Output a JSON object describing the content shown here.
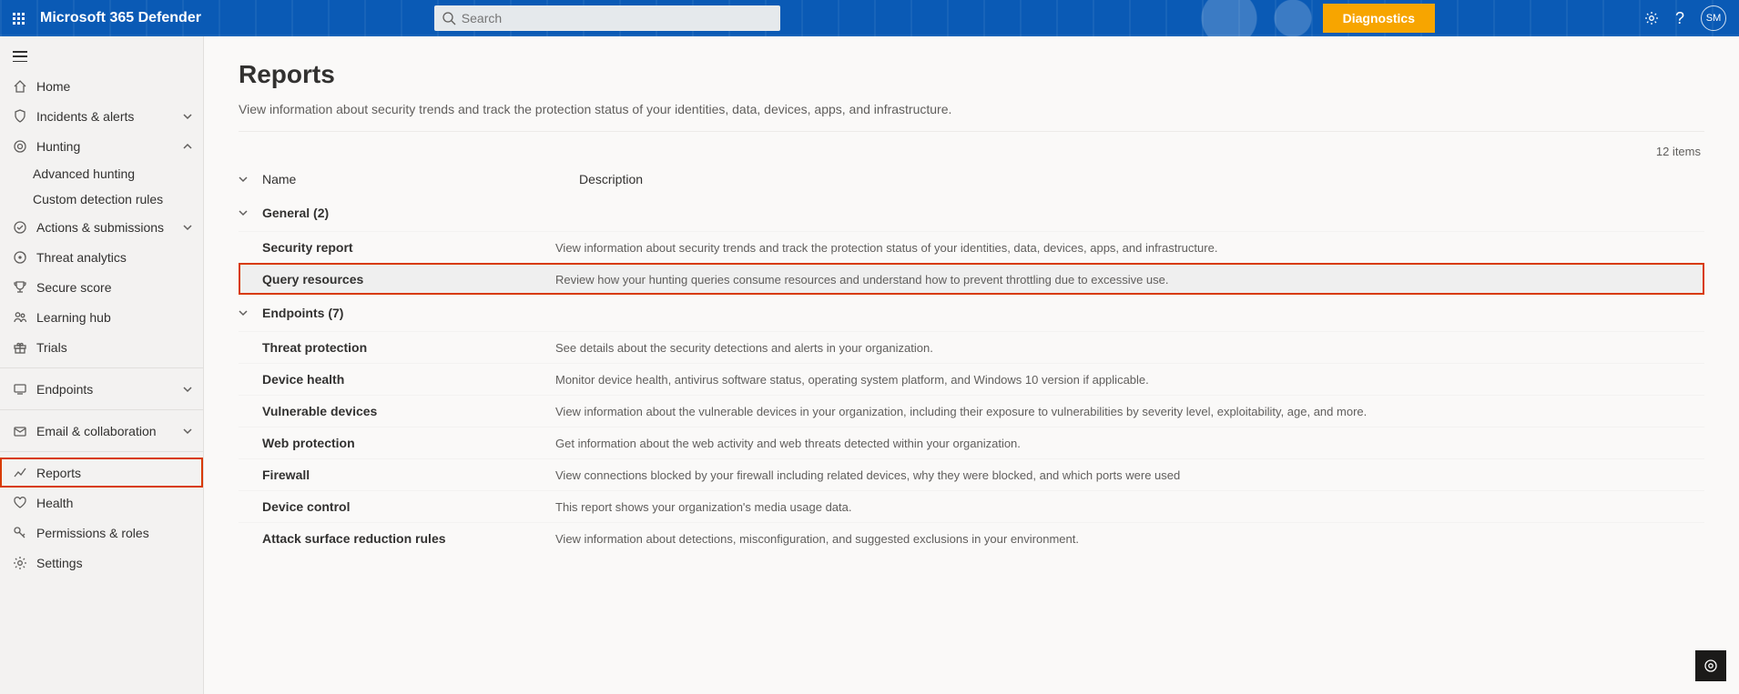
{
  "header": {
    "app_title": "Microsoft 365 Defender",
    "search_placeholder": "Search",
    "diagnostics_label": "Diagnostics",
    "avatar_initials": "SM"
  },
  "sidebar": {
    "items": [
      {
        "id": "home",
        "label": "Home",
        "icon": "home"
      },
      {
        "id": "incidents",
        "label": "Incidents & alerts",
        "icon": "shield",
        "chev": "down"
      },
      {
        "id": "hunting",
        "label": "Hunting",
        "icon": "target",
        "chev": "up",
        "children": [
          {
            "id": "adv-hunt",
            "label": "Advanced hunting"
          },
          {
            "id": "custom-rules",
            "label": "Custom detection rules"
          }
        ]
      },
      {
        "id": "actions",
        "label": "Actions & submissions",
        "icon": "check",
        "chev": "down"
      },
      {
        "id": "threat",
        "label": "Threat analytics",
        "icon": "radar"
      },
      {
        "id": "score",
        "label": "Secure score",
        "icon": "trophy"
      },
      {
        "id": "learn",
        "label": "Learning hub",
        "icon": "people"
      },
      {
        "id": "trials",
        "label": "Trials",
        "icon": "gift"
      },
      {
        "divider": true
      },
      {
        "id": "endpoints",
        "label": "Endpoints",
        "icon": "device",
        "chev": "down"
      },
      {
        "divider": true
      },
      {
        "id": "email",
        "label": "Email & collaboration",
        "icon": "mail",
        "chev": "down"
      },
      {
        "divider": true
      },
      {
        "id": "reports",
        "label": "Reports",
        "icon": "chart",
        "selected": true
      },
      {
        "id": "health",
        "label": "Health",
        "icon": "heart"
      },
      {
        "id": "perms",
        "label": "Permissions & roles",
        "icon": "key"
      },
      {
        "id": "settings",
        "label": "Settings",
        "icon": "gear"
      }
    ]
  },
  "page": {
    "title": "Reports",
    "subtitle": "View information about security trends and track the protection status of your identities, data, devices, apps, and infrastructure.",
    "item_count": "12 items",
    "columns": {
      "name": "Name",
      "description": "Description"
    },
    "groups": [
      {
        "header": "General (2)",
        "rows": [
          {
            "name": "Security report",
            "desc": "View information about security trends and track the protection status of your identities, data, devices, apps, and infrastructure."
          },
          {
            "name": "Query resources",
            "desc": "Review how your hunting queries consume resources and understand how to prevent throttling due to excessive use.",
            "highlight": true
          }
        ]
      },
      {
        "header": "Endpoints (7)",
        "rows": [
          {
            "name": "Threat protection",
            "desc": "See details about the security detections and alerts in your organization."
          },
          {
            "name": "Device health",
            "desc": "Monitor device health, antivirus software status, operating system platform, and Windows 10 version if applicable."
          },
          {
            "name": "Vulnerable devices",
            "desc": "View information about the vulnerable devices in your organization, including their exposure to vulnerabilities by severity level, exploitability, age, and more."
          },
          {
            "name": "Web protection",
            "desc": "Get information about the web activity and web threats detected within your organization."
          },
          {
            "name": "Firewall",
            "desc": "View connections blocked by your firewall including related devices, why they were blocked, and which ports were used"
          },
          {
            "name": "Device control",
            "desc": "This report shows your organization's media usage data."
          },
          {
            "name": "Attack surface reduction rules",
            "desc": "View information about detections, misconfiguration, and suggested exclusions in your environment."
          }
        ]
      }
    ]
  }
}
